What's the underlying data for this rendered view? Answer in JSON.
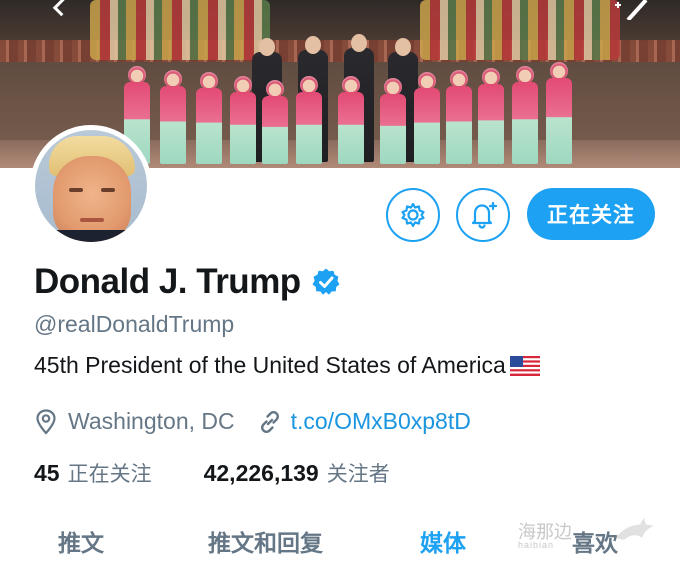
{
  "profile": {
    "display_name": "Donald J. Trump",
    "handle": "@realDonaldTrump",
    "bio": "45th President of the United States of America",
    "location": "Washington, DC",
    "link": "t.co/OMxB0xp8tD"
  },
  "actions": {
    "follow_label": "正在关注"
  },
  "stats": {
    "following_count": "45",
    "following_label": "正在关注",
    "followers_count": "42,226,139",
    "followers_label": "关注者"
  },
  "tabs": [
    {
      "label": "推文",
      "active": false
    },
    {
      "label": "推文和回复",
      "active": false
    },
    {
      "label": "媒体",
      "active": true
    },
    {
      "label": "喜欢",
      "active": false
    }
  ],
  "watermark": {
    "text": "海那边",
    "sub": "haibian"
  },
  "icons": {
    "back": "chevron-left-icon",
    "compose": "compose-icon",
    "settings": "gear-icon",
    "notifications": "bell-plus-icon",
    "verified": "verified-badge-icon",
    "location": "location-pin-icon",
    "link": "link-icon",
    "flag": "us-flag-icon"
  },
  "colors": {
    "accent": "#1da1f2",
    "link": "#1b95e0",
    "secondary_text": "#657786",
    "primary_text": "#14171a"
  }
}
